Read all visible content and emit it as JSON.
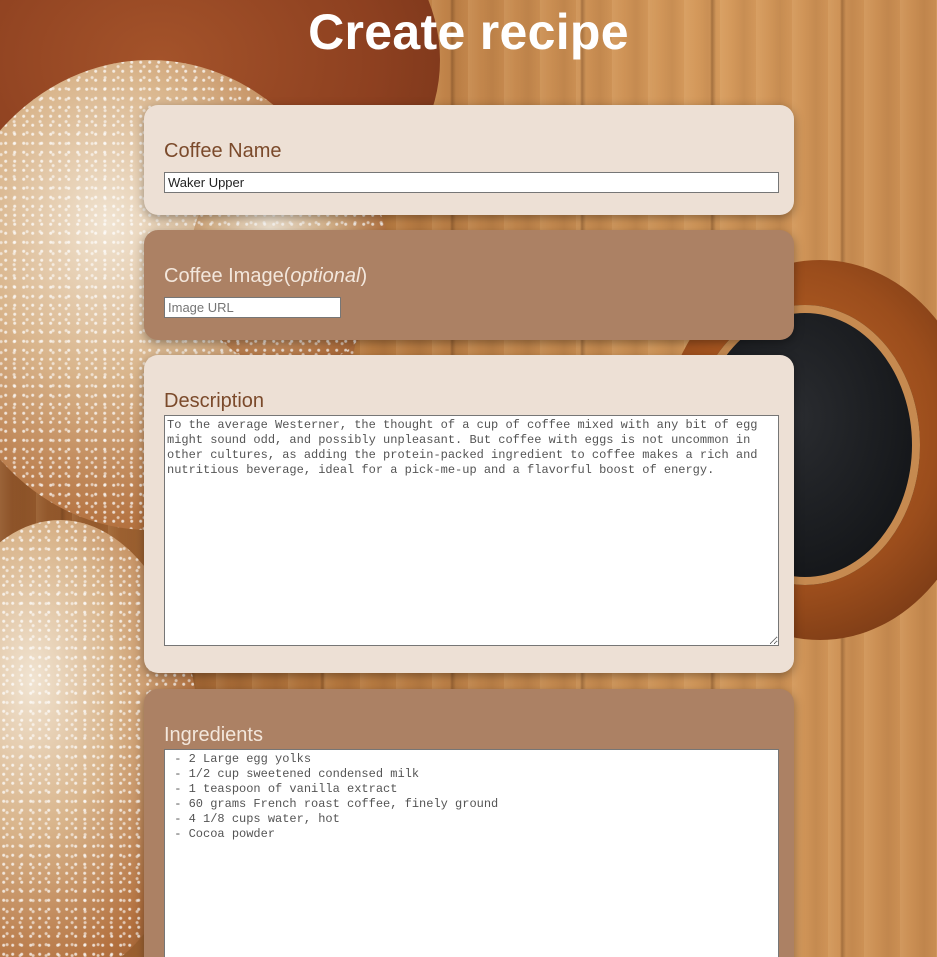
{
  "page": {
    "title": "Create recipe"
  },
  "form": {
    "name": {
      "label": "Coffee Name",
      "value": "Waker Upper"
    },
    "image": {
      "label": "Coffee Image(",
      "label_optional": "optional",
      "label_close": ")",
      "placeholder": "Image URL",
      "value": ""
    },
    "description": {
      "label": "Description",
      "value": "To the average Westerner, the thought of a cup of coffee mixed with any bit of egg might sound odd, and possibly unpleasant. But coffee with eggs is not uncommon in other cultures, as adding the protein-packed ingredient to coffee makes a rich and nutritious beverage, ideal for a pick-me-up and a flavorful boost of energy."
    },
    "ingredients": {
      "label": "Ingredients",
      "value": " - 2 Large egg yolks\n - 1/2 cup sweetened condensed milk\n - 1 teaspoon of vanilla extract\n - 60 grams French roast coffee, finely ground\n - 4 1/8 cups water, hot\n - Cocoa powder"
    }
  },
  "colors": {
    "card_light": "#ede0d5",
    "card_dark": "#ac8164",
    "label_dark": "#7b4a2b",
    "label_light": "#f3e7dc",
    "title": "#ffffff"
  }
}
